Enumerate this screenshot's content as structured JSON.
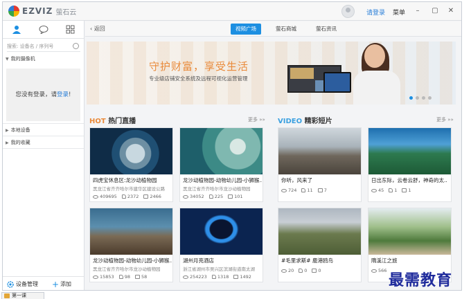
{
  "window": {
    "brand": "EZVIZ",
    "brand_cn": "萤石云",
    "login_link": "请登录",
    "menu_label": "菜单",
    "minimize": "–",
    "maximize": "▢",
    "close": "✕"
  },
  "left_panel": {
    "search_placeholder": "搜索: 设备名 / 序列号",
    "my_cameras": "我的摄像机",
    "not_logged_prefix": "您没有登录，请",
    "not_logged_link": "登录",
    "not_logged_suffix": "!",
    "local_devices": "本地设备",
    "my_favorites": "我的收藏",
    "device_mgmt": "设备管理",
    "add": "添加"
  },
  "nav": {
    "back": "返回",
    "tabs": [
      "视频广场",
      "萤石商城",
      "萤石资讯"
    ]
  },
  "banner": {
    "title": "守护财富，享受生活",
    "subtitle": "专业级店铺安全系统及远程可视化运营管理"
  },
  "sections": {
    "hot_prefix": "HOT",
    "hot_title": "热门直播",
    "video_prefix": "VIDEO",
    "video_title": "精彩短片",
    "more": "更多 »»"
  },
  "hot_cards": [
    {
      "title": "四虎宝休息区:龙沙动植物园",
      "subtitle": "黑龙江省齐齐哈尔市建华区建设公路",
      "views": "409695",
      "likes": "2372",
      "comments": "2466"
    },
    {
      "title": "龙沙动植物园-动物幼儿园-小狮猴..",
      "subtitle": "黑龙江省齐齐哈尔市龙沙动植物园",
      "views": "34052",
      "likes": "225",
      "comments": "101"
    },
    {
      "title": "龙沙动植物园-动物幼儿园-小狮猴..",
      "subtitle": "黑龙江省齐齐哈尔市龙沙动植物园",
      "views": "15853",
      "likes": "98",
      "comments": "58"
    },
    {
      "title": "湖州月亮酒店",
      "subtitle": "浙江省湖州市吴兴区滨湖街道南太湖",
      "views": "254223",
      "likes": "1318",
      "comments": "1492"
    }
  ],
  "video_cards": [
    {
      "title": "你听，风来了",
      "views": "724",
      "likes": "11",
      "comments": "7"
    },
    {
      "title": "日出东际，云卷云舒，神奇的太..",
      "views": "45",
      "likes": "1",
      "comments": "1"
    },
    {
      "title": "#毛里求斯# 鹿港鸥鸟",
      "views": "20",
      "likes": "0",
      "comments": "0"
    },
    {
      "title": "隋溪江之旅",
      "views": "566",
      "likes": "",
      "comments": ""
    }
  ],
  "watermark": "最需教育",
  "taskbar_label": "第一课",
  "colors": {
    "accent": "#1d8fe1",
    "hot": "#e98a3a",
    "video": "#3aa0e0"
  }
}
